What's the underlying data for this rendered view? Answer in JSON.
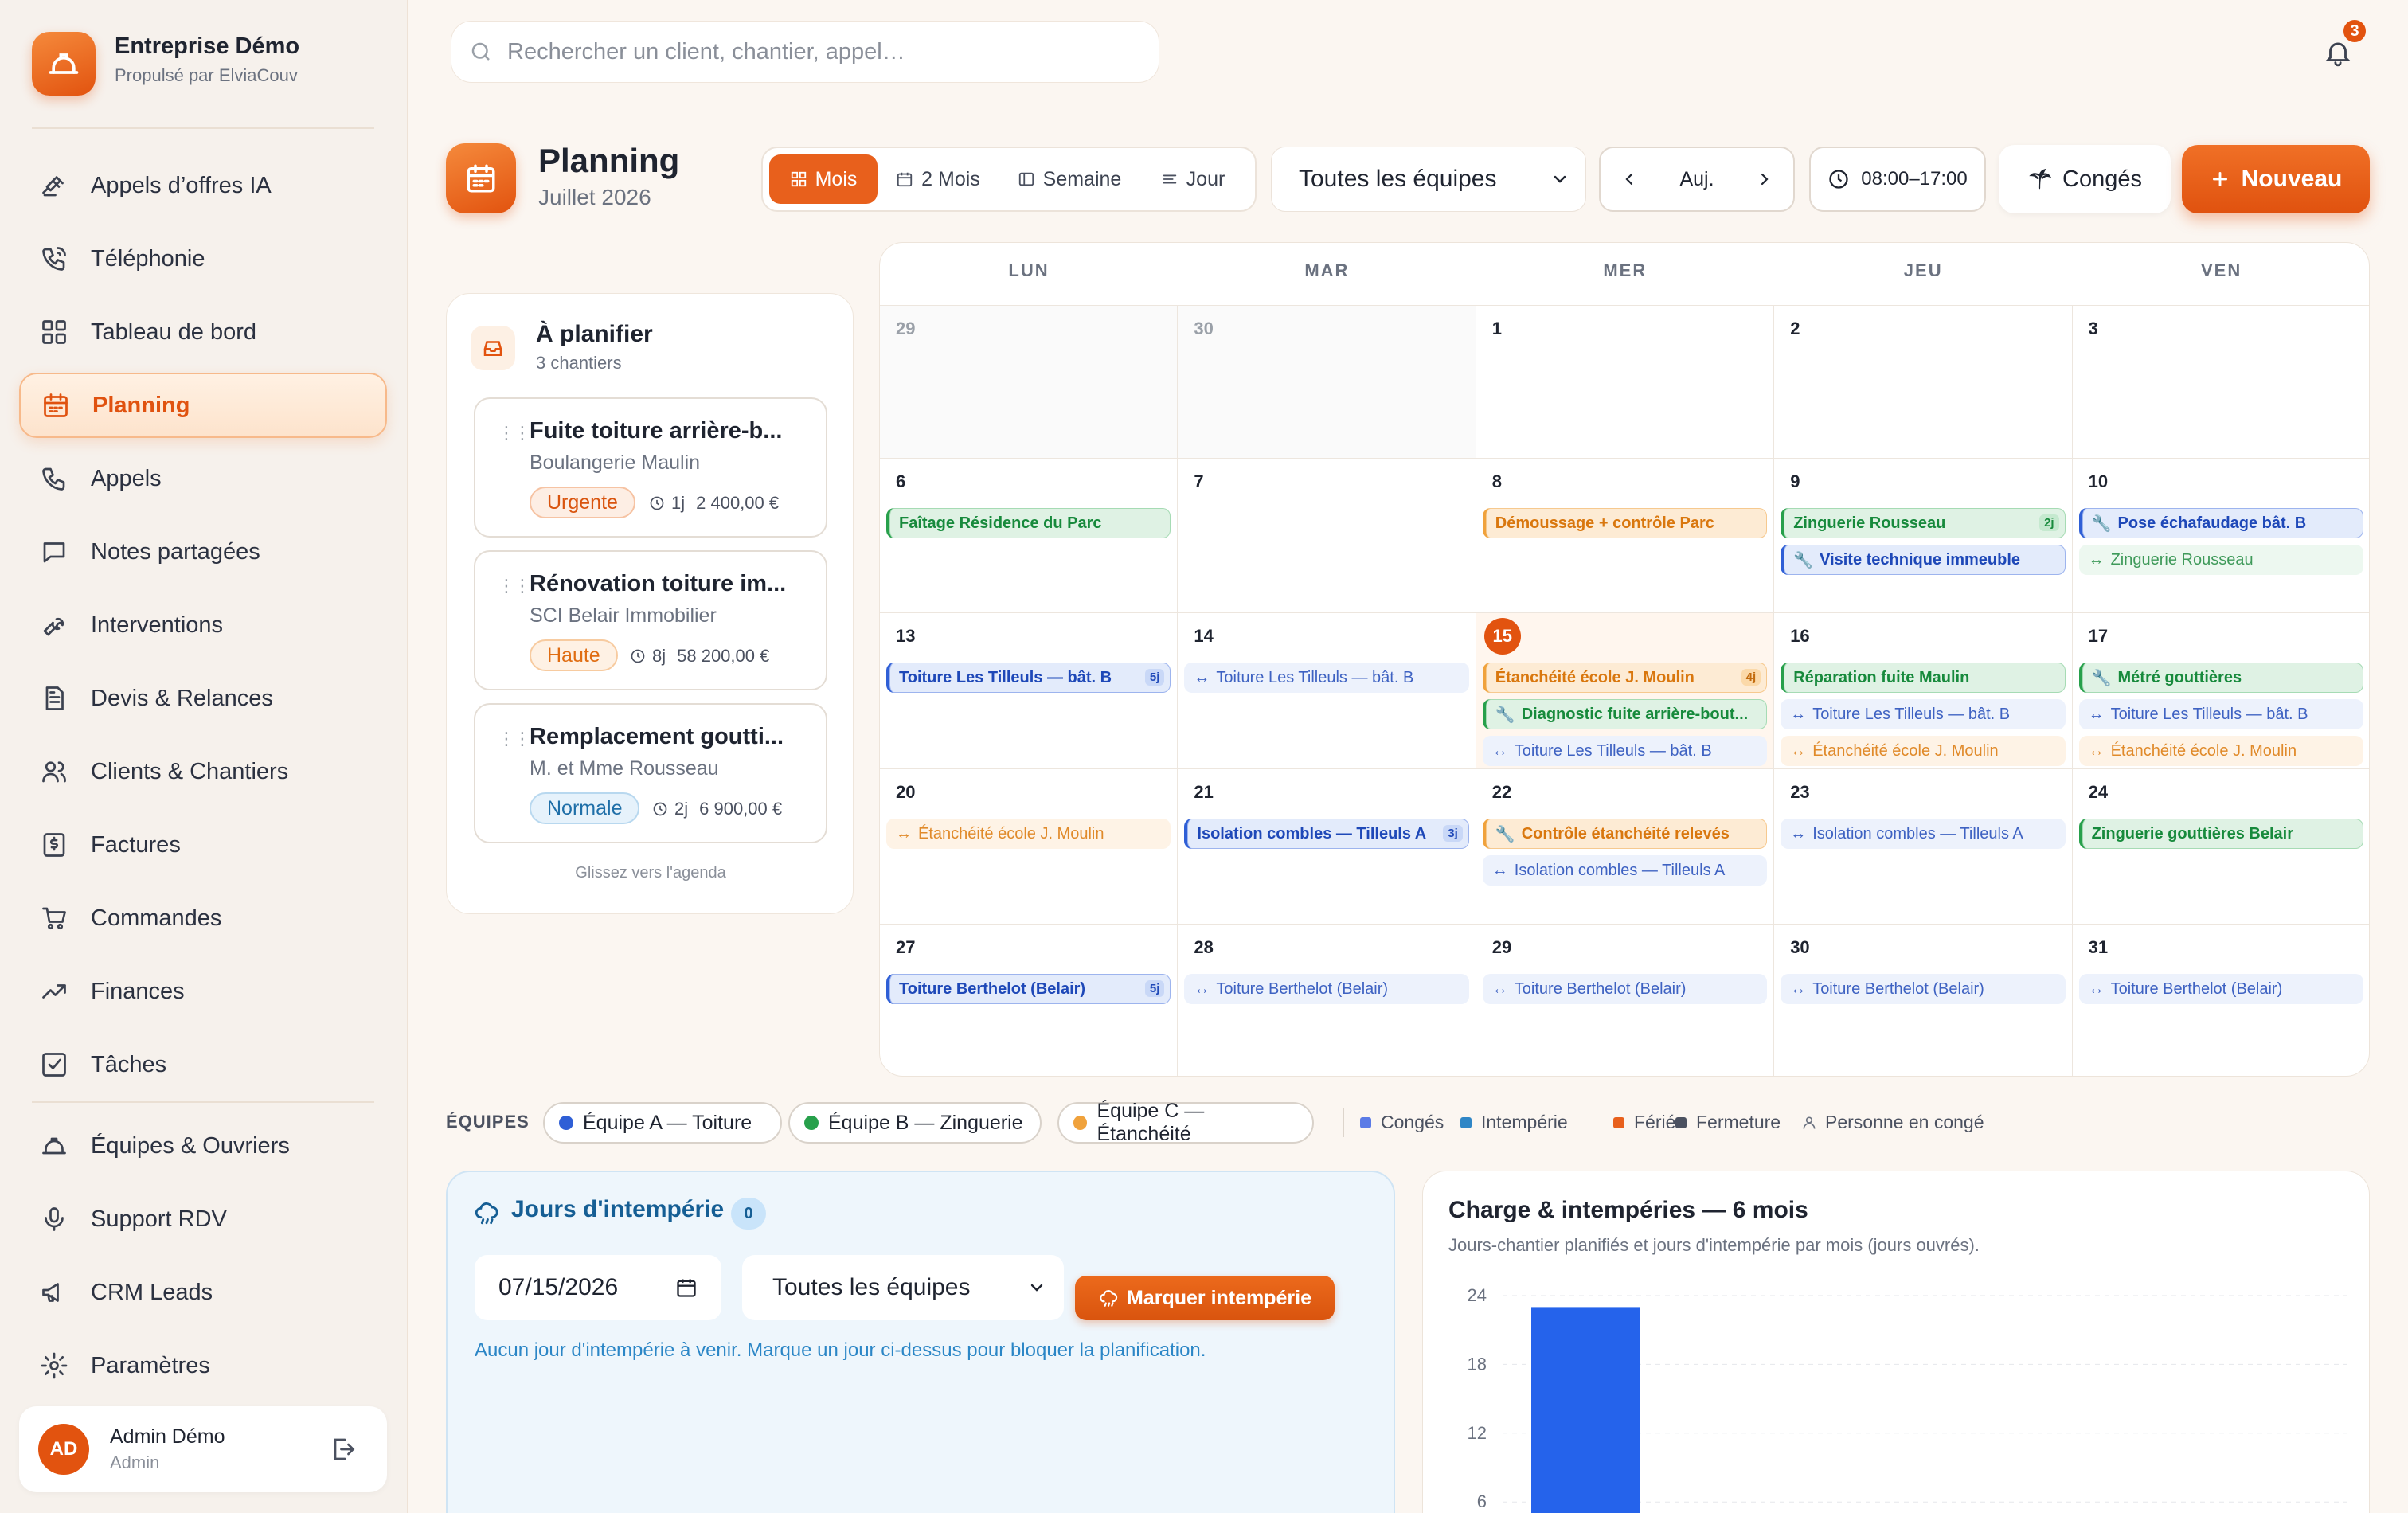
{
  "brand": {
    "name": "Entreprise Démo",
    "sub": "Propulsé par ElviaCouv"
  },
  "nav": [
    {
      "label": "Appels d’offres IA",
      "icon": "gavel-icon"
    },
    {
      "label": "Téléphonie",
      "icon": "phone-ring-icon"
    },
    {
      "label": "Tableau de bord",
      "icon": "dashboard-icon"
    },
    {
      "label": "Planning",
      "icon": "calendar-icon",
      "active": true
    },
    {
      "label": "Appels",
      "icon": "phone-icon"
    },
    {
      "label": "Notes partagées",
      "icon": "chat-icon"
    },
    {
      "label": "Interventions",
      "icon": "wrench-icon"
    },
    {
      "label": "Devis & Relances",
      "icon": "document-icon"
    },
    {
      "label": "Clients & Chantiers",
      "icon": "users-icon"
    },
    {
      "label": "Factures",
      "icon": "invoice-icon"
    },
    {
      "label": "Commandes",
      "icon": "cart-icon"
    },
    {
      "label": "Finances",
      "icon": "trend-icon"
    },
    {
      "label": "Tâches",
      "icon": "checkbox-icon"
    },
    {
      "label": "Équipes & Ouvriers",
      "icon": "helmet-icon"
    },
    {
      "label": "Support RDV",
      "icon": "mic-icon"
    },
    {
      "label": "CRM Leads",
      "icon": "megaphone-icon"
    },
    {
      "label": "Paramètres",
      "icon": "gear-icon"
    }
  ],
  "user": {
    "initials": "AD",
    "name": "Admin Démo",
    "role": "Admin"
  },
  "search": {
    "placeholder": "Rechercher un client, chantier, appel…"
  },
  "notifications": {
    "count": "3"
  },
  "header": {
    "title": "Planning",
    "subtitle": "Juillet 2026"
  },
  "views": [
    {
      "label": "Mois",
      "active": true
    },
    {
      "label": "2 Mois"
    },
    {
      "label": "Semaine"
    },
    {
      "label": "Jour"
    }
  ],
  "team_filter": "Toutes les équipes",
  "nav_today": "Auj.",
  "hours": "08:00–17:00",
  "conges_label": "Congés",
  "new_label": "Nouveau",
  "to_plan": {
    "title": "À planifier",
    "subtitle": "3 chantiers",
    "hint": "Glissez vers l'agenda",
    "cards": [
      {
        "title": "Fuite toiture arrière-b...",
        "client": "Boulangerie Maulin",
        "priority": "Urgente",
        "prio_style": "urgent",
        "duration": "1j",
        "amount": "2 400,00 €"
      },
      {
        "title": "Rénovation toiture im...",
        "client": "SCI Belair Immobilier",
        "priority": "Haute",
        "prio_style": "high",
        "duration": "8j",
        "amount": "58 200,00 €"
      },
      {
        "title": "Remplacement goutti...",
        "client": "M. et Mme Rousseau",
        "priority": "Normale",
        "prio_style": "normal",
        "duration": "2j",
        "amount": "6 900,00 €"
      }
    ]
  },
  "calendar": {
    "days": [
      "LUN",
      "MAR",
      "MER",
      "JEU",
      "VEN"
    ],
    "weeks": [
      [
        {
          "d": "29",
          "dim": true,
          "events": []
        },
        {
          "d": "30",
          "dim": true,
          "events": []
        },
        {
          "d": "1",
          "events": []
        },
        {
          "d": "2",
          "events": []
        },
        {
          "d": "3",
          "events": []
        }
      ],
      [
        {
          "d": "6",
          "events": [
            {
              "t": "Faîtage Résidence du Parc",
              "c": "green",
              "k": "main"
            }
          ]
        },
        {
          "d": "7",
          "events": []
        },
        {
          "d": "8",
          "events": [
            {
              "t": "Démoussage + contrôle Parc",
              "c": "orange",
              "k": "main"
            }
          ]
        },
        {
          "d": "9",
          "events": [
            {
              "t": "Zinguerie Rousseau",
              "c": "green",
              "k": "main",
              "dur": "2j"
            },
            {
              "t": "Visite technique immeuble",
              "c": "blue",
              "k": "main",
              "tool": true
            }
          ]
        },
        {
          "d": "10",
          "events": [
            {
              "t": "Pose échafaudage bât. B",
              "c": "blue",
              "k": "main",
              "tool": true
            },
            {
              "t": "Zinguerie Rousseau",
              "c": "green",
              "k": "cont"
            }
          ]
        }
      ],
      [
        {
          "d": "13",
          "events": [
            {
              "t": "Toiture Les Tilleuls — bât. B",
              "c": "blue",
              "k": "main",
              "dur": "5j"
            }
          ]
        },
        {
          "d": "14",
          "events": [
            {
              "t": "Toiture Les Tilleuls — bât. B",
              "c": "blue",
              "k": "cont"
            }
          ]
        },
        {
          "d": "15",
          "today": true,
          "events": [
            {
              "t": "Étanchéité école J. Moulin",
              "c": "orange",
              "k": "main",
              "dur": "4j"
            },
            {
              "t": "Diagnostic fuite arrière-bout...",
              "c": "green",
              "k": "main",
              "tool": true
            },
            {
              "t": "Toiture Les Tilleuls — bât. B",
              "c": "blue",
              "k": "cont"
            }
          ]
        },
        {
          "d": "16",
          "events": [
            {
              "t": "Réparation fuite Maulin",
              "c": "green",
              "k": "main"
            },
            {
              "t": "Toiture Les Tilleuls — bât. B",
              "c": "blue",
              "k": "cont"
            },
            {
              "t": "Étanchéité école J. Moulin",
              "c": "orange",
              "k": "cont"
            }
          ]
        },
        {
          "d": "17",
          "events": [
            {
              "t": "Métré gouttières",
              "c": "green",
              "k": "main",
              "tool": true
            },
            {
              "t": "Toiture Les Tilleuls — bât. B",
              "c": "blue",
              "k": "cont"
            },
            {
              "t": "Étanchéité école J. Moulin",
              "c": "orange",
              "k": "cont"
            }
          ]
        }
      ],
      [
        {
          "d": "20",
          "events": [
            {
              "t": "Étanchéité école J. Moulin",
              "c": "orange",
              "k": "cont"
            }
          ]
        },
        {
          "d": "21",
          "events": [
            {
              "t": "Isolation combles — Tilleuls A",
              "c": "blue",
              "k": "main",
              "dur": "3j"
            }
          ]
        },
        {
          "d": "22",
          "events": [
            {
              "t": "Contrôle étanchéité relevés",
              "c": "orange",
              "k": "main",
              "tool": true
            },
            {
              "t": "Isolation combles — Tilleuls A",
              "c": "blue",
              "k": "cont"
            }
          ]
        },
        {
          "d": "23",
          "events": [
            {
              "t": "Isolation combles — Tilleuls A",
              "c": "blue",
              "k": "cont"
            }
          ]
        },
        {
          "d": "24",
          "events": [
            {
              "t": "Zinguerie gouttières Belair",
              "c": "green",
              "k": "main"
            }
          ]
        }
      ],
      [
        {
          "d": "27",
          "events": [
            {
              "t": "Toiture Berthelot (Belair)",
              "c": "blue",
              "k": "main",
              "dur": "5j"
            }
          ]
        },
        {
          "d": "28",
          "events": [
            {
              "t": "Toiture Berthelot (Belair)",
              "c": "blue",
              "k": "cont"
            }
          ]
        },
        {
          "d": "29",
          "events": [
            {
              "t": "Toiture Berthelot (Belair)",
              "c": "blue",
              "k": "cont"
            }
          ]
        },
        {
          "d": "30",
          "events": [
            {
              "t": "Toiture Berthelot (Belair)",
              "c": "blue",
              "k": "cont"
            }
          ]
        },
        {
          "d": "31",
          "events": [
            {
              "t": "Toiture Berthelot (Belair)",
              "c": "blue",
              "k": "cont"
            }
          ]
        }
      ]
    ]
  },
  "legend": {
    "label": "ÉQUIPES",
    "teams": [
      {
        "label": "Équipe A — Toiture",
        "color": "#2f5fd6"
      },
      {
        "label": "Équipe B — Zinguerie",
        "color": "#27a04b"
      },
      {
        "label": "Équipe C — Étanchéité",
        "color": "#f0a23c"
      }
    ],
    "items": [
      {
        "label": "Congés",
        "color": "#5b7be6"
      },
      {
        "label": "Intempérie",
        "color": "#2f86c6"
      },
      {
        "label": "Férié",
        "color": "#e8601c"
      },
      {
        "label": "Fermeture",
        "color": "#4b5160"
      },
      {
        "label": "Personne en congé",
        "icon": "person-icon"
      }
    ]
  },
  "weather": {
    "title": "Jours d'intempérie",
    "count": "0",
    "date": "07/15/2026",
    "team": "Toutes les équipes",
    "button": "Marquer intempérie",
    "message": "Aucun jour d'intempérie à venir. Marque un jour ci-dessus pour bloquer la planification."
  },
  "chart_panel": {
    "title": "Charge & intempéries — 6 mois",
    "subtitle": "Jours-chantier planifiés et jours d'intempérie par mois (jours ouvrés)."
  },
  "chart_data": {
    "type": "bar",
    "title": "Charge & intempéries — 6 mois",
    "yticks": [
      24,
      18,
      12,
      6
    ],
    "ylim": [
      0,
      24
    ],
    "series": [
      {
        "values": [
          23
        ],
        "color": "#2563eb"
      }
    ],
    "grid": true
  }
}
